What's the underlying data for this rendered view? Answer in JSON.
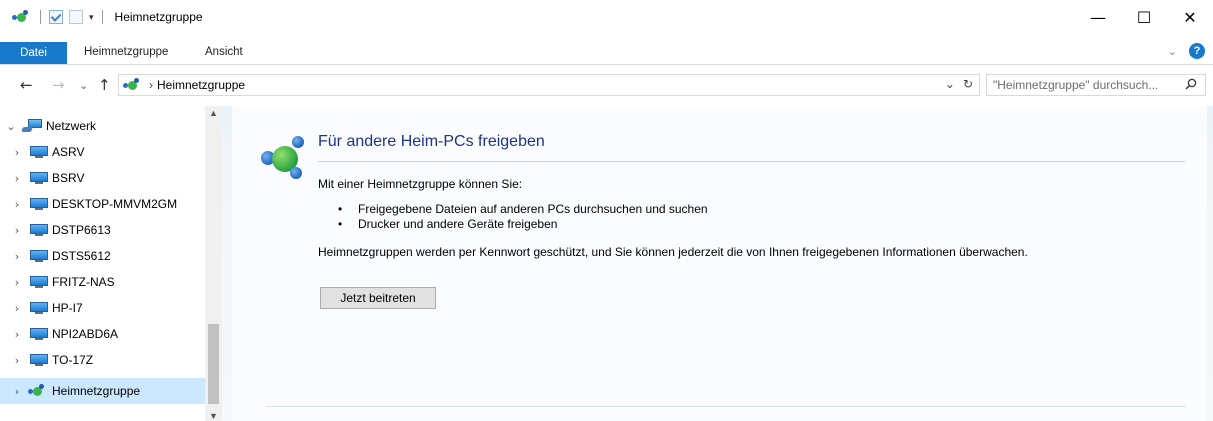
{
  "window": {
    "title": "Heimnetzgruppe",
    "controls": {
      "minimize": "—",
      "maximize": "☐",
      "close": "✕"
    }
  },
  "quick_access": {
    "dropdown": "▾"
  },
  "ribbon": {
    "tabs": [
      "Datei",
      "Heimnetzgruppe",
      "Ansicht"
    ],
    "active_tab": "Datei",
    "collapse_chevron": "⌄",
    "help": "?",
    "accent_color": "#1979ca"
  },
  "navigation": {
    "back": "←",
    "forward": "→",
    "recent": "⌄",
    "up": "↑"
  },
  "address_bar": {
    "separator": "›",
    "path": "Heimnetzgruppe",
    "dropdown": "⌄",
    "refresh": "↻"
  },
  "search": {
    "placeholder": "\"Heimnetzgruppe\" durchsuch...",
    "icon": "search-icon"
  },
  "nav_pane": {
    "root": {
      "label": "Netzwerk",
      "expanded": true,
      "chevron": "⌄"
    },
    "computers": [
      {
        "label": "ASRV",
        "chevron": "›"
      },
      {
        "label": "BSRV",
        "chevron": "›"
      },
      {
        "label": "DESKTOP-MMVM2GM",
        "chevron": "›"
      },
      {
        "label": "DSTP6613",
        "chevron": "›"
      },
      {
        "label": "DSTS5612",
        "chevron": "›"
      },
      {
        "label": "FRITZ-NAS",
        "chevron": "›"
      },
      {
        "label": "HP-I7",
        "chevron": "›"
      },
      {
        "label": "NPI2ABD6A",
        "chevron": "›"
      },
      {
        "label": "TO-17Z",
        "chevron": "›"
      }
    ],
    "homegroup": {
      "label": "Heimnetzgruppe",
      "selected": true,
      "chevron": "›"
    },
    "scroll_up": "▲",
    "scroll_down": "▼",
    "selected_color": "#cce8ff"
  },
  "content": {
    "heading": "Für andere Heim-PCs freigeben",
    "intro": "Mit einer Heimnetzgruppe können Sie:",
    "bullets": [
      "Freigegebene Dateien auf anderen PCs durchsuchen und suchen",
      "Drucker und andere Geräte freigeben"
    ],
    "description": "Heimnetzgruppen werden per Kennwort geschützt, und Sie können jederzeit die von Ihnen freigegebenen Informationen überwachen.",
    "join_button": "Jetzt beitreten",
    "heading_color": "#1e3287"
  }
}
